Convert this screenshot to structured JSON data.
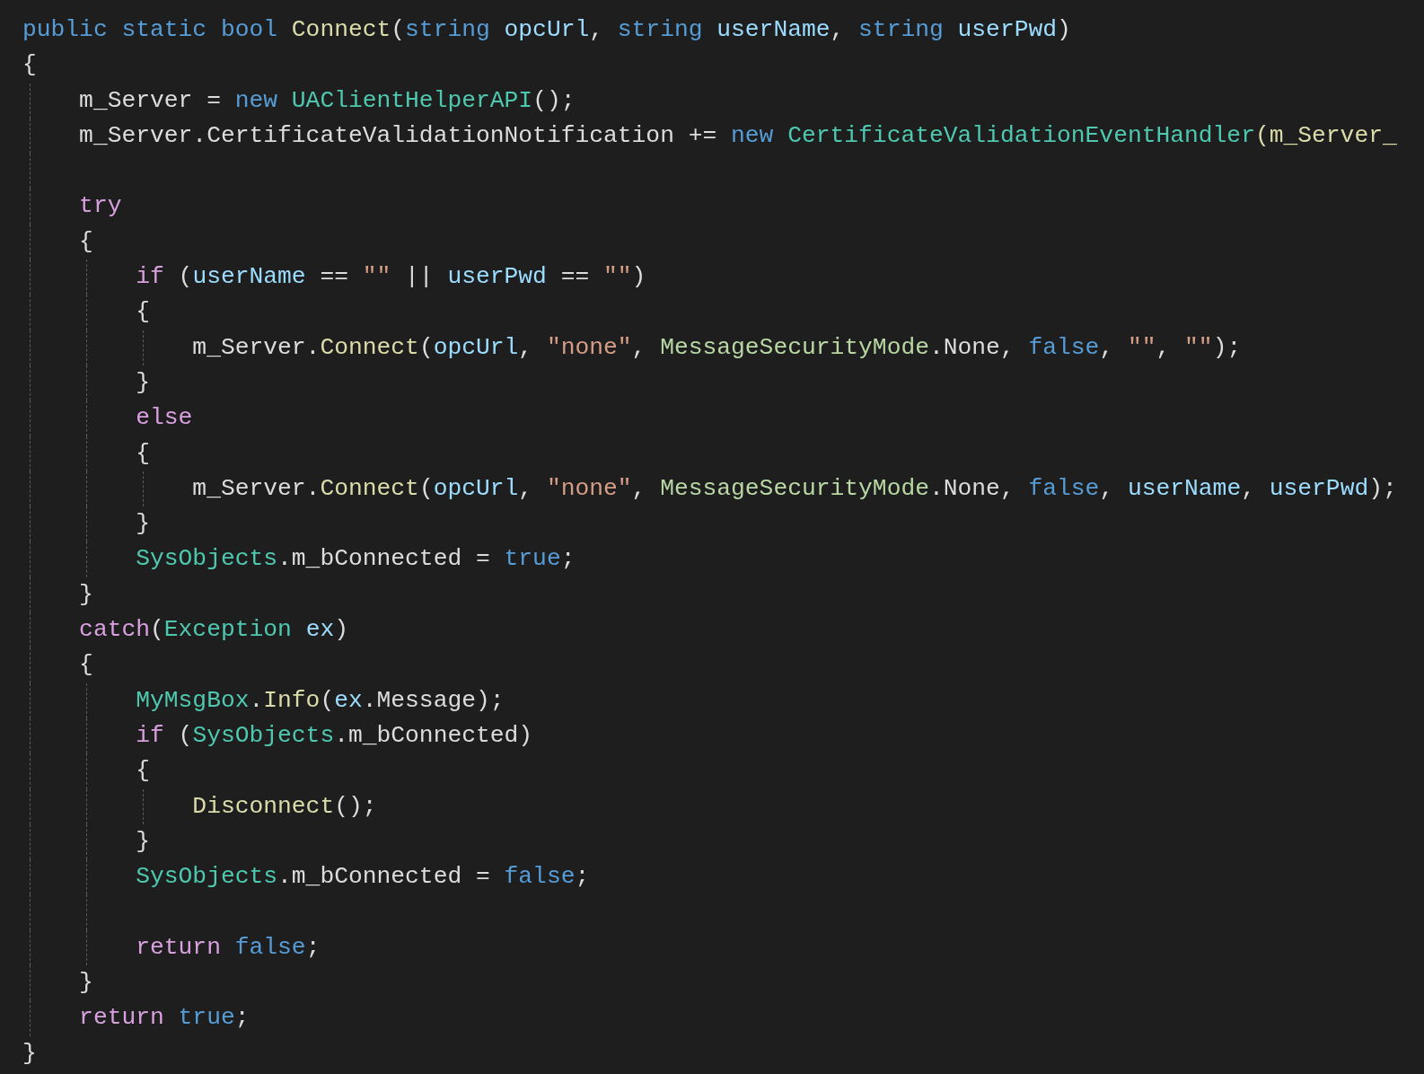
{
  "editor": {
    "lines": [
      {
        "kind": "code",
        "tokens": [
          {
            "text": "public static bool ",
            "kind": "kw"
          },
          {
            "text": "Connect",
            "kind": "fn"
          },
          {
            "text": "(",
            "kind": "plain"
          },
          {
            "text": "string ",
            "kind": "kw"
          },
          {
            "text": "opcUrl",
            "kind": "var"
          },
          {
            "text": ", ",
            "kind": "plain"
          },
          {
            "text": "string ",
            "kind": "kw"
          },
          {
            "text": "userName",
            "kind": "var"
          },
          {
            "text": ", ",
            "kind": "plain"
          },
          {
            "text": "string ",
            "kind": "kw"
          },
          {
            "text": "userPwd",
            "kind": "var"
          },
          {
            "text": ")",
            "kind": "plain"
          }
        ]
      },
      {
        "kind": "code",
        "tokens": [
          {
            "text": "{",
            "kind": "plain"
          }
        ]
      },
      {
        "kind": "code",
        "tokens": [
          {
            "text": "    m_Server = ",
            "kind": "plain"
          },
          {
            "text": "new ",
            "kind": "kw"
          },
          {
            "text": "UAClientHelperAPI",
            "kind": "type"
          },
          {
            "text": "();",
            "kind": "plain"
          }
        ]
      },
      {
        "kind": "code",
        "tokens": [
          {
            "text": "    m_Server.CertificateValidationNotification += ",
            "kind": "plain"
          },
          {
            "text": "new ",
            "kind": "kw"
          },
          {
            "text": "CertificateValidationEventHandler",
            "kind": "type"
          },
          {
            "text": "(m_Server_",
            "kind": "fn"
          }
        ]
      },
      {
        "kind": "blank"
      },
      {
        "kind": "code",
        "tokens": [
          {
            "text": "    try",
            "kind": "ctl"
          }
        ]
      },
      {
        "kind": "code",
        "tokens": [
          {
            "text": "    {",
            "kind": "plain"
          }
        ]
      },
      {
        "kind": "code",
        "tokens": [
          {
            "text": "        if",
            "kind": "ctl"
          },
          {
            "text": " (",
            "kind": "plain"
          },
          {
            "text": "userName",
            "kind": "var"
          },
          {
            "text": " == ",
            "kind": "plain"
          },
          {
            "text": "\"\"",
            "kind": "str"
          },
          {
            "text": " || ",
            "kind": "plain"
          },
          {
            "text": "userPwd",
            "kind": "var"
          },
          {
            "text": " == ",
            "kind": "plain"
          },
          {
            "text": "\"\"",
            "kind": "str"
          },
          {
            "text": ")",
            "kind": "plain"
          }
        ]
      },
      {
        "kind": "code",
        "tokens": [
          {
            "text": "        {",
            "kind": "plain"
          }
        ]
      },
      {
        "kind": "code",
        "tokens": [
          {
            "text": "            m_Server.",
            "kind": "plain"
          },
          {
            "text": "Connect",
            "kind": "fn"
          },
          {
            "text": "(",
            "kind": "plain"
          },
          {
            "text": "opcUrl",
            "kind": "var"
          },
          {
            "text": ", ",
            "kind": "plain"
          },
          {
            "text": "\"none\"",
            "kind": "str"
          },
          {
            "text": ", ",
            "kind": "plain"
          },
          {
            "text": "MessageSecurityMode",
            "kind": "enum"
          },
          {
            "text": ".None, ",
            "kind": "plain"
          },
          {
            "text": "false",
            "kind": "kw"
          },
          {
            "text": ", ",
            "kind": "plain"
          },
          {
            "text": "\"\"",
            "kind": "str"
          },
          {
            "text": ", ",
            "kind": "plain"
          },
          {
            "text": "\"\"",
            "kind": "str"
          },
          {
            "text": ");",
            "kind": "plain"
          }
        ]
      },
      {
        "kind": "code",
        "tokens": [
          {
            "text": "        }",
            "kind": "plain"
          }
        ]
      },
      {
        "kind": "code",
        "tokens": [
          {
            "text": "        else",
            "kind": "ctl"
          }
        ]
      },
      {
        "kind": "code",
        "tokens": [
          {
            "text": "        {",
            "kind": "plain"
          }
        ]
      },
      {
        "kind": "code",
        "tokens": [
          {
            "text": "            m_Server.",
            "kind": "plain"
          },
          {
            "text": "Connect",
            "kind": "fn"
          },
          {
            "text": "(",
            "kind": "plain"
          },
          {
            "text": "opcUrl",
            "kind": "var"
          },
          {
            "text": ", ",
            "kind": "plain"
          },
          {
            "text": "\"none\"",
            "kind": "str"
          },
          {
            "text": ", ",
            "kind": "plain"
          },
          {
            "text": "MessageSecurityMode",
            "kind": "enum"
          },
          {
            "text": ".None, ",
            "kind": "plain"
          },
          {
            "text": "false",
            "kind": "kw"
          },
          {
            "text": ", ",
            "kind": "plain"
          },
          {
            "text": "userName",
            "kind": "var"
          },
          {
            "text": ", ",
            "kind": "plain"
          },
          {
            "text": "userPwd",
            "kind": "var"
          },
          {
            "text": ");",
            "kind": "plain"
          }
        ]
      },
      {
        "kind": "code",
        "tokens": [
          {
            "text": "        }",
            "kind": "plain"
          }
        ]
      },
      {
        "kind": "code",
        "tokens": [
          {
            "text": "        SysObjects",
            "kind": "type"
          },
          {
            "text": ".m_bConnected = ",
            "kind": "plain"
          },
          {
            "text": "true",
            "kind": "kw"
          },
          {
            "text": ";",
            "kind": "plain"
          }
        ]
      },
      {
        "kind": "code",
        "tokens": [
          {
            "text": "    }",
            "kind": "plain"
          }
        ]
      },
      {
        "kind": "code",
        "tokens": [
          {
            "text": "    catch",
            "kind": "ctl"
          },
          {
            "text": "(",
            "kind": "plain"
          },
          {
            "text": "Exception ",
            "kind": "type"
          },
          {
            "text": "ex",
            "kind": "var"
          },
          {
            "text": ")",
            "kind": "plain"
          }
        ]
      },
      {
        "kind": "code",
        "tokens": [
          {
            "text": "    {",
            "kind": "plain"
          }
        ]
      },
      {
        "kind": "code",
        "tokens": [
          {
            "text": "        MyMsgBox",
            "kind": "type"
          },
          {
            "text": ".",
            "kind": "plain"
          },
          {
            "text": "Info",
            "kind": "fn"
          },
          {
            "text": "(",
            "kind": "plain"
          },
          {
            "text": "ex",
            "kind": "var"
          },
          {
            "text": ".Message);",
            "kind": "plain"
          }
        ]
      },
      {
        "kind": "code",
        "tokens": [
          {
            "text": "        if",
            "kind": "ctl"
          },
          {
            "text": " (",
            "kind": "plain"
          },
          {
            "text": "SysObjects",
            "kind": "type"
          },
          {
            "text": ".m_bConnected)",
            "kind": "plain"
          }
        ]
      },
      {
        "kind": "code",
        "tokens": [
          {
            "text": "        {",
            "kind": "plain"
          }
        ]
      },
      {
        "kind": "code",
        "tokens": [
          {
            "text": "            Disconnect",
            "kind": "fn"
          },
          {
            "text": "();",
            "kind": "plain"
          }
        ]
      },
      {
        "kind": "code",
        "tokens": [
          {
            "text": "        }",
            "kind": "plain"
          }
        ]
      },
      {
        "kind": "code",
        "tokens": [
          {
            "text": "        SysObjects",
            "kind": "type"
          },
          {
            "text": ".m_bConnected = ",
            "kind": "plain"
          },
          {
            "text": "false",
            "kind": "kw"
          },
          {
            "text": ";",
            "kind": "plain"
          }
        ]
      },
      {
        "kind": "blank"
      },
      {
        "kind": "code",
        "tokens": [
          {
            "text": "        return ",
            "kind": "ctl"
          },
          {
            "text": "false",
            "kind": "kw"
          },
          {
            "text": ";",
            "kind": "plain"
          }
        ]
      },
      {
        "kind": "code",
        "tokens": [
          {
            "text": "    }",
            "kind": "plain"
          }
        ]
      },
      {
        "kind": "code",
        "tokens": [
          {
            "text": "    return ",
            "kind": "ctl"
          },
          {
            "text": "true",
            "kind": "kw"
          },
          {
            "text": ";",
            "kind": "plain"
          }
        ]
      },
      {
        "kind": "code",
        "tokens": [
          {
            "text": "}",
            "kind": "plain"
          }
        ]
      }
    ]
  }
}
